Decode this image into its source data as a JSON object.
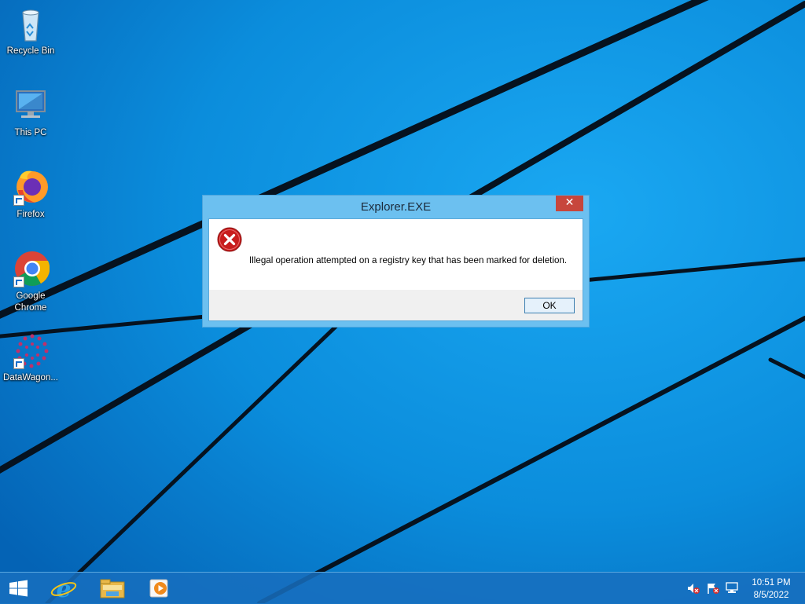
{
  "desktop": {
    "icons": [
      {
        "label": "Recycle Bin",
        "icon": "recycle-bin-icon"
      },
      {
        "label": "This PC",
        "icon": "computer-icon"
      },
      {
        "label": "Firefox",
        "icon": "firefox-icon"
      },
      {
        "label": "Google\nChrome",
        "icon": "chrome-icon"
      },
      {
        "label": "DataWagon...",
        "icon": "datawagon-icon"
      }
    ]
  },
  "dialog": {
    "title": "Explorer.EXE",
    "close_label": "✕",
    "message": "Illegal operation attempted on a registry key that has been marked for deletion.",
    "ok_label": "OK",
    "icon": "error-icon"
  },
  "taskbar": {
    "items": [
      {
        "icon": "windows-start-icon"
      },
      {
        "icon": "internet-explorer-icon"
      },
      {
        "icon": "file-explorer-icon"
      },
      {
        "icon": "media-player-icon"
      }
    ],
    "tray": {
      "icons": [
        "volume-muted-icon",
        "action-center-flag-icon",
        "network-icon"
      ],
      "time": "10:51 PM",
      "date": "8/5/2022"
    }
  },
  "colors": {
    "wallpaper_blue": "#0b84d6",
    "close_red": "#c7463c",
    "dialog_frame": "#6cc0f0"
  }
}
